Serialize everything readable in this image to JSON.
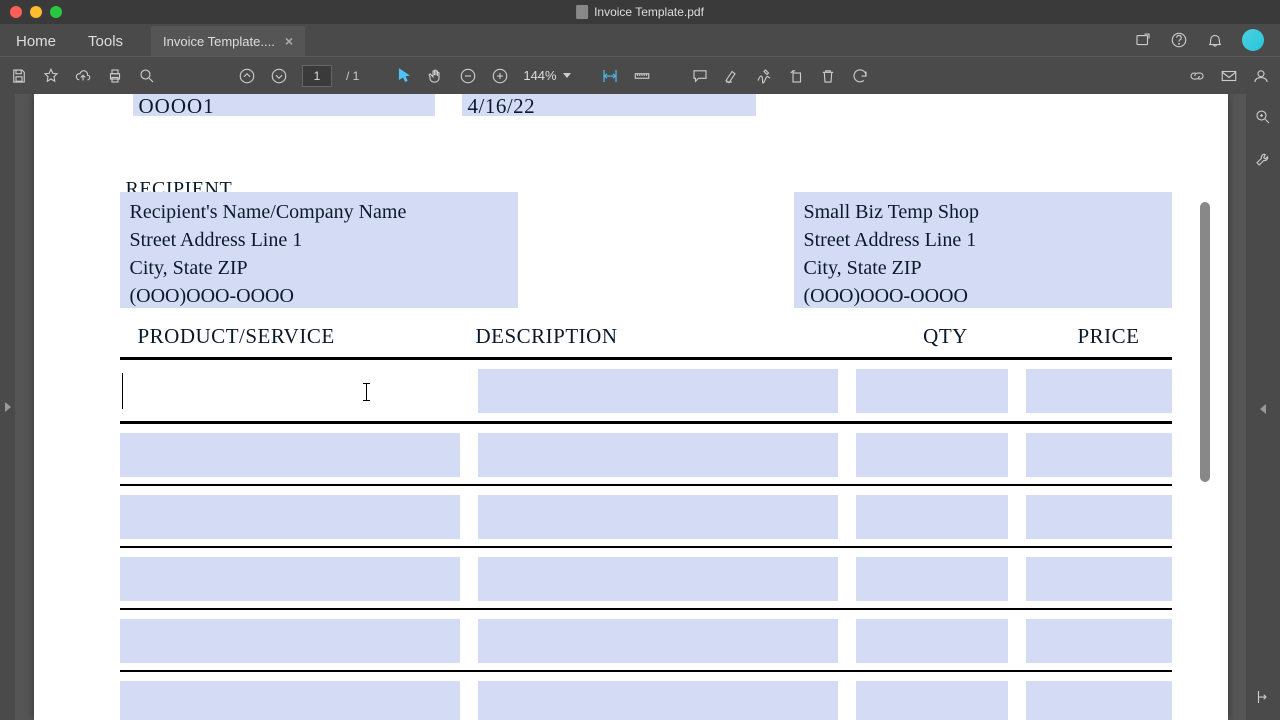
{
  "window": {
    "title": "Invoice Template.pdf"
  },
  "nav": {
    "home": "Home",
    "tools": "Tools"
  },
  "tab": {
    "label": "Invoice Template...."
  },
  "toolbar": {
    "page_current": "1",
    "page_total": "/  1",
    "zoom": "144%"
  },
  "invoice": {
    "number": "OOOO1",
    "date": "4/16/22",
    "recipient_label": "RECIPIENT",
    "recipient": {
      "name": "Recipient's Name/Company Name",
      "street": "Street Address Line 1",
      "city": "City, State ZIP",
      "phone": "(OOO)OOO-OOOO"
    },
    "sender": {
      "name": "Small Biz Temp Shop",
      "street": "Street Address Line 1",
      "city": "City, State ZIP",
      "phone": "(OOO)OOO-OOOO"
    },
    "columns": {
      "product": "PRODUCT/SERVICE",
      "description": "DESCRIPTION",
      "qty": "QTY",
      "price": "PRICE"
    }
  }
}
